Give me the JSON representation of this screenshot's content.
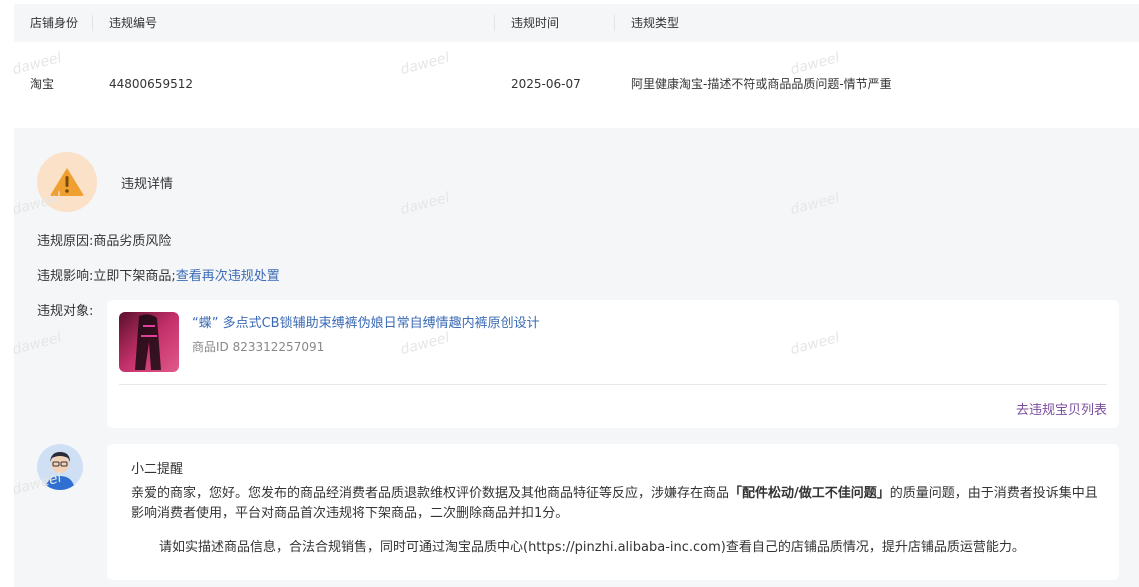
{
  "table": {
    "headers": [
      "店铺身份",
      "违规编号",
      "违规时间",
      "违规类型"
    ],
    "row": {
      "shop_identity": "淘宝",
      "violation_id": "44800659512",
      "violation_time": "2025-06-07",
      "violation_type": "阿里健康淘宝-描述不符或商品品质问题-情节严重"
    }
  },
  "detail": {
    "title": "违规详情",
    "reason_label": "违规原因:",
    "reason_value": "商品劣质风险",
    "impact_label": "违规影响:",
    "impact_value": "立即下架商品;",
    "impact_link": "查看再次违规处置",
    "object_label": "违规对象:"
  },
  "product": {
    "title": "“蝶” 多点式CB锁辅助束缚裤伪娘日常自缚情趣内裤原创设计",
    "id_label": "商品ID",
    "id_value": "823312257091",
    "list_link": "去违规宝贝列表"
  },
  "reminder": {
    "title": "小二提醒",
    "text_before": "亲爱的商家，您好。您发布的商品经消费者品质退款维权评价数据及其他商品特征等反应，涉嫌存在商品",
    "text_bold": "「配件松动/做工不佳问题」",
    "text_after": "的质量问题，由于消费者投诉集中且影响消费者使用，平台对商品首次违规将下架商品，二次删除商品并扣1分。",
    "text2": "请如实描述商品信息，合法合规销售，同时可通过淘宝品质中心(https://pinzhi.alibaba-inc.com)查看自己的店铺品质情况，提升店铺品质运营能力。"
  },
  "watermark": "daweel",
  "colors": {
    "link": "#3b6bb6",
    "list_link": "#7a4d9e",
    "warning": "#f0a030",
    "panel": "#f5f6f8"
  },
  "icons": {
    "warning": "warning-triangle-icon",
    "avatar": "support-agent-avatar"
  }
}
